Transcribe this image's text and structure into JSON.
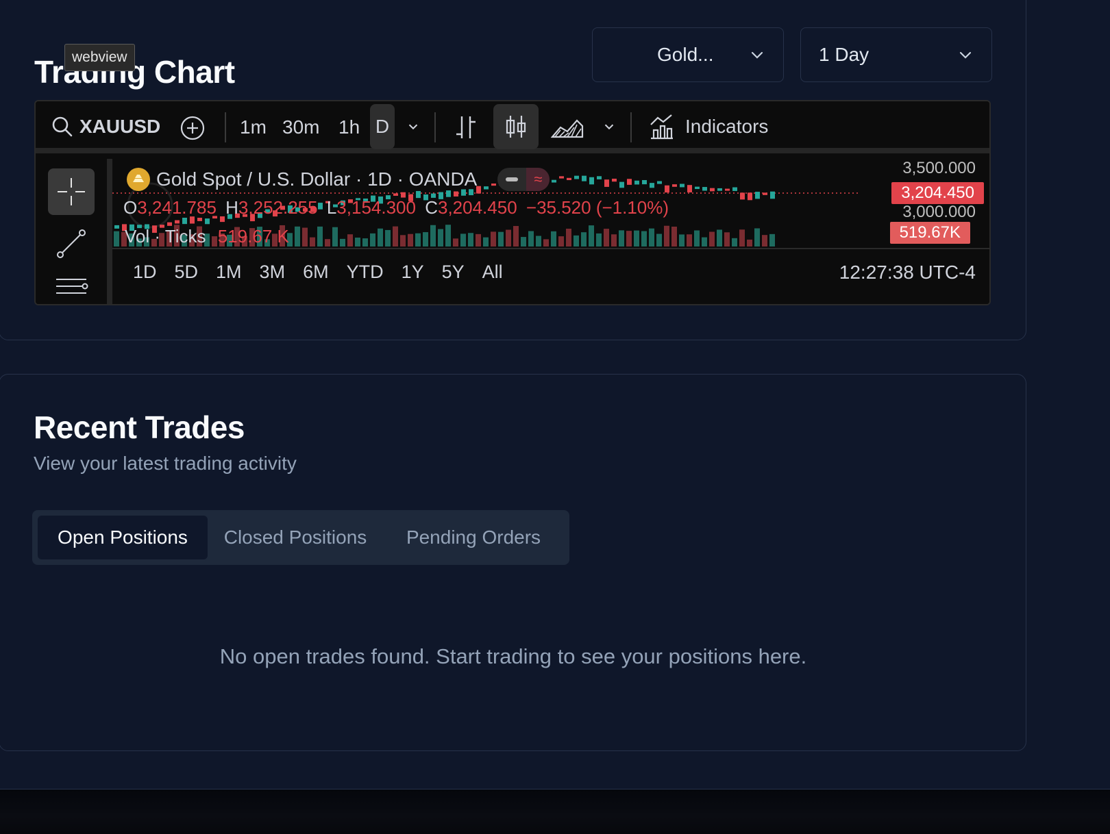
{
  "chart_card": {
    "title": "Trading Chart",
    "tooltip": "webview",
    "asset_select": "Gold...",
    "range_select": "1 Day"
  },
  "widget": {
    "symbol": "XAUUSD",
    "intervals": [
      "1m",
      "30m",
      "1h",
      "D"
    ],
    "indicators_label": "Indicators",
    "instrument": "Gold Spot / U.S. Dollar · 1D · OANDA",
    "ohlc": {
      "o_label": "O",
      "o": "3,241.785",
      "h_label": "H",
      "h": "3,252.255",
      "l_label": "L",
      "l": "3,154.300",
      "c_label": "C",
      "c": "3,204.450",
      "change": "−35.520 (−1.10%)"
    },
    "volume_label": "Vol · Ticks",
    "volume_value": "519.67 K",
    "price_axis": {
      "top": "3,500.000",
      "mid": "3,000.000"
    },
    "last_price": "3,204.450",
    "last_volume": "519.67K",
    "ranges": [
      "1D",
      "5D",
      "1M",
      "3M",
      "6M",
      "YTD",
      "1Y",
      "5Y",
      "All"
    ],
    "clock": "12:27:38 UTC-4",
    "colors": {
      "up": "#26a69a",
      "down": "#e2434b"
    }
  },
  "trades_card": {
    "title": "Recent Trades",
    "subtitle": "View your latest trading activity",
    "tabs": [
      "Open Positions",
      "Closed Positions",
      "Pending Orders"
    ],
    "active_tab": "Open Positions",
    "empty_message": "No open trades found. Start trading to see your positions here."
  }
}
